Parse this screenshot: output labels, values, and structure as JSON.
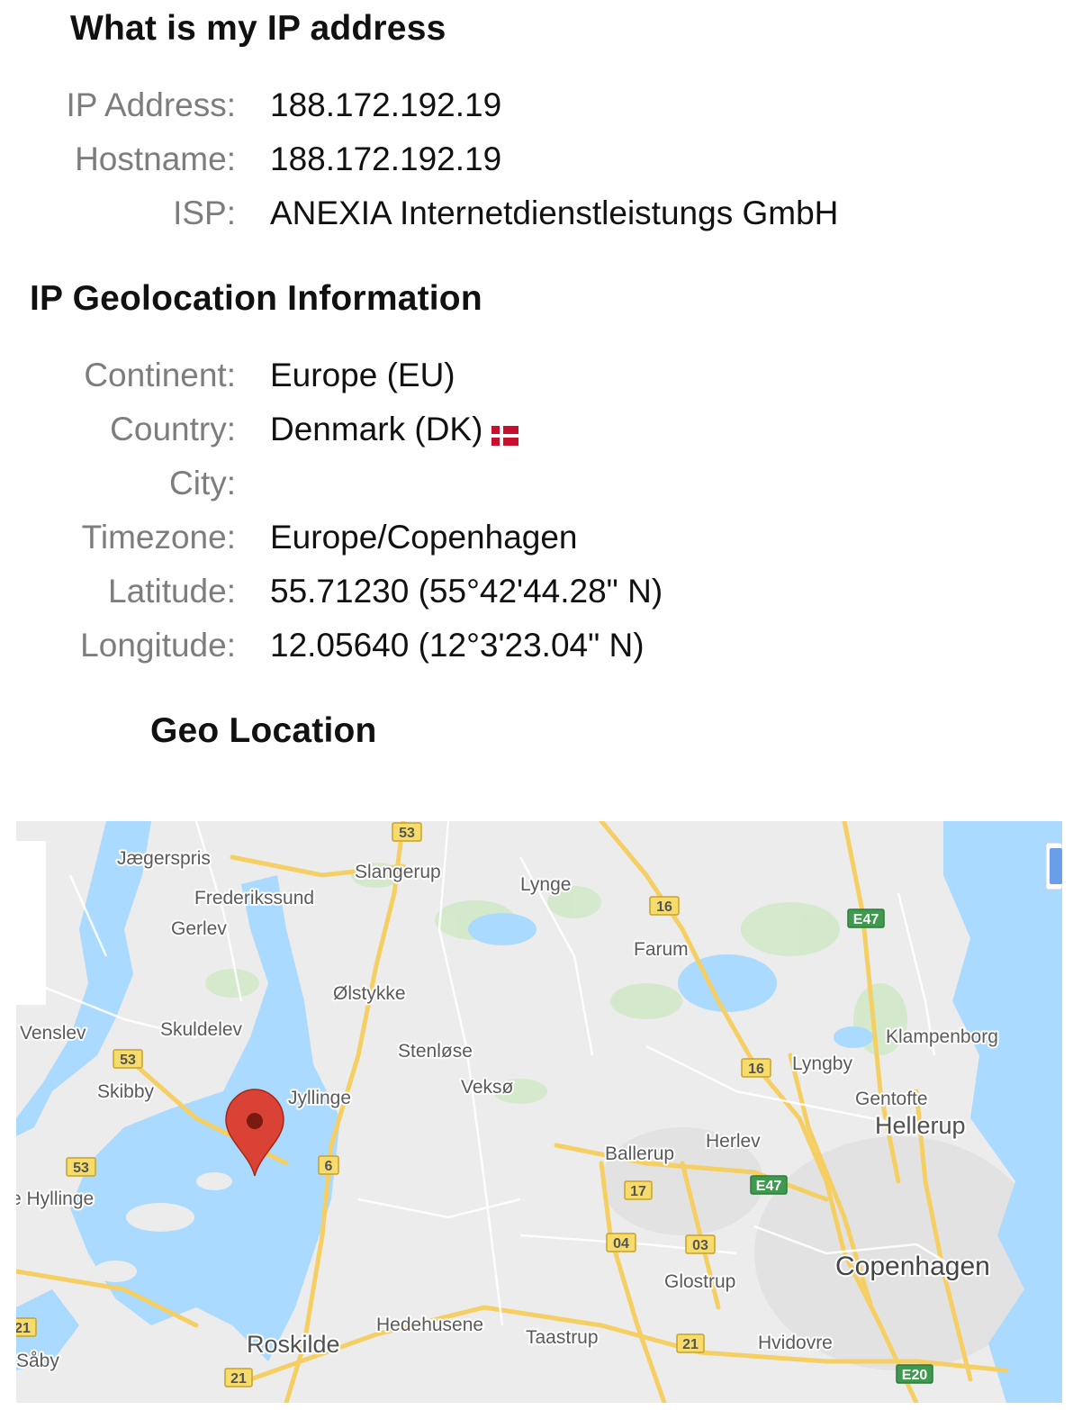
{
  "section1": {
    "title": "What is my IP address",
    "rows": [
      {
        "label": "IP Address:",
        "value": "188.172.192.19"
      },
      {
        "label": "Hostname:",
        "value": "188.172.192.19"
      },
      {
        "label": "ISP:",
        "value": "ANEXIA Internetdienstleistungs GmbH"
      }
    ]
  },
  "section2": {
    "title": "IP Geolocation Information",
    "rows": [
      {
        "label": "Continent:",
        "value": "Europe (EU)"
      },
      {
        "label": "Country:",
        "value": "Denmark (DK)",
        "icon": "denmark-flag-icon"
      },
      {
        "label": "City:",
        "value": ""
      },
      {
        "label": "Timezone:",
        "value": "Europe/Copenhagen"
      },
      {
        "label": "Latitude:",
        "value": "55.71230 (55°42'44.28\" N)"
      },
      {
        "label": "Longitude:",
        "value": "12.05640 (12°3'23.04\" N)"
      }
    ]
  },
  "geo": {
    "title": "Geo Location",
    "map": {
      "marker_icon": "map-pin-icon",
      "colors": {
        "water": "#aadaff",
        "land": "#ececec",
        "road": "#f5cf63",
        "marker": "#d94235"
      },
      "places": [
        "Jægerspris",
        "Slangerup",
        "Lynge",
        "Frederikssund",
        "Gerlev",
        "Farum",
        "Ølstykke",
        "Venslev",
        "Skuldelev",
        "Stenløse",
        "Klampenborg",
        "Lyngby",
        "Skibby",
        "Veksø",
        "Jyllinge",
        "Gentofte",
        "Hellerup",
        "Herlev",
        "Ballerup",
        "e Hyllinge",
        "Glostrup",
        "Copenhagen",
        "Hedehusene",
        "Roskilde",
        "Taastrup",
        "Hvidovre",
        "Såby"
      ],
      "route_shields": [
        "53",
        "16",
        "E47",
        "53",
        "16",
        "53",
        "6",
        "17",
        "E47",
        "04",
        "03",
        "21",
        "21",
        "21",
        "E20"
      ]
    }
  }
}
